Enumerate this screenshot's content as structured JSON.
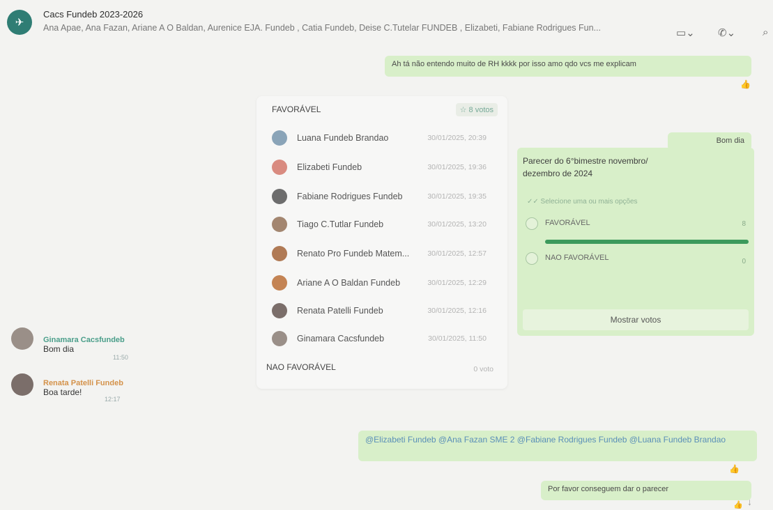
{
  "header": {
    "title": "Cacs Fundeb 2023-2026",
    "members": "Ana Apae, Ana Fazan, Ariane A O Baldan, Aurenice EJA. Fundeb , Catia Fundeb, Deise C.Tutelar FUNDEB , Elizabeti, Fabiane Rodrigues Fun...",
    "video_icon": "video-icon",
    "call_icon": "phone-icon",
    "search_icon": "search-icon"
  },
  "messages": {
    "m1": {
      "text": "Ah tá não entendo muito de RH kkkk por isso amo qdo vcs me explicam"
    },
    "m2": {
      "text": "Bom dia"
    },
    "m3_sender": "Ginamara Cacsfundeb",
    "m3_text": "Bom dia",
    "m3_time": "11:50",
    "m4_sender": "Renata Patelli Fundeb",
    "m4_text": "Boa tarde!",
    "m4_time": "12:17",
    "m5": {
      "text": "@Elizabeti Fundeb @Ana Fazan SME 2 @Fabiane Rodrigues Fundeb @Luana Fundeb Brandao"
    },
    "m6": {
      "text": "Por favor conseguem dar o parecer"
    }
  },
  "votes_panel": {
    "fav_label": "FAVORÁVEL",
    "fav_count": "☆ 8 votos",
    "voters": [
      {
        "name": "Luana Fundeb Brandao",
        "date": "30/01/2025, 20:39",
        "color": "#8aa4b8"
      },
      {
        "name": "Elizabeti Fundeb",
        "date": "30/01/2025, 19:36",
        "color": "#d98b80"
      },
      {
        "name": "Fabiane Rodrigues Fundeb",
        "date": "30/01/2025, 19:35",
        "color": "#6d6d6d"
      },
      {
        "name": "Tiago C.Tutlar Fundeb",
        "date": "30/01/2025, 13:20",
        "color": "#a38670"
      },
      {
        "name": "Renato Pro Fundeb Matem...",
        "date": "30/01/2025, 12:57",
        "color": "#b07a55"
      },
      {
        "name": "Ariane A O Baldan Fundeb",
        "date": "30/01/2025, 12:29",
        "color": "#c48454"
      },
      {
        "name": "Renata Patelli Fundeb",
        "date": "30/01/2025, 12:16",
        "color": "#7b6e6a"
      },
      {
        "name": "Ginamara Cacsfundeb",
        "date": "30/01/2025, 11:50",
        "color": "#9a8f88"
      }
    ],
    "nao_label": "NAO FAVORÁVEL",
    "nao_count": "0 voto"
  },
  "poll": {
    "question": "Parecer do 6°bimestre novembro/ dezembro de 2024",
    "hint": "Selecione uma ou mais opções",
    "options": [
      {
        "label": "FAVORÁVEL",
        "votes": "8",
        "fraction": 1.0
      },
      {
        "label": "NAO FAVORÁVEL",
        "votes": "0",
        "fraction": 0.0
      }
    ],
    "show_votes": "Mostrar votos"
  },
  "colors": {
    "bubble_out": "#d8efc9",
    "accent": "#3c9a5c"
  }
}
